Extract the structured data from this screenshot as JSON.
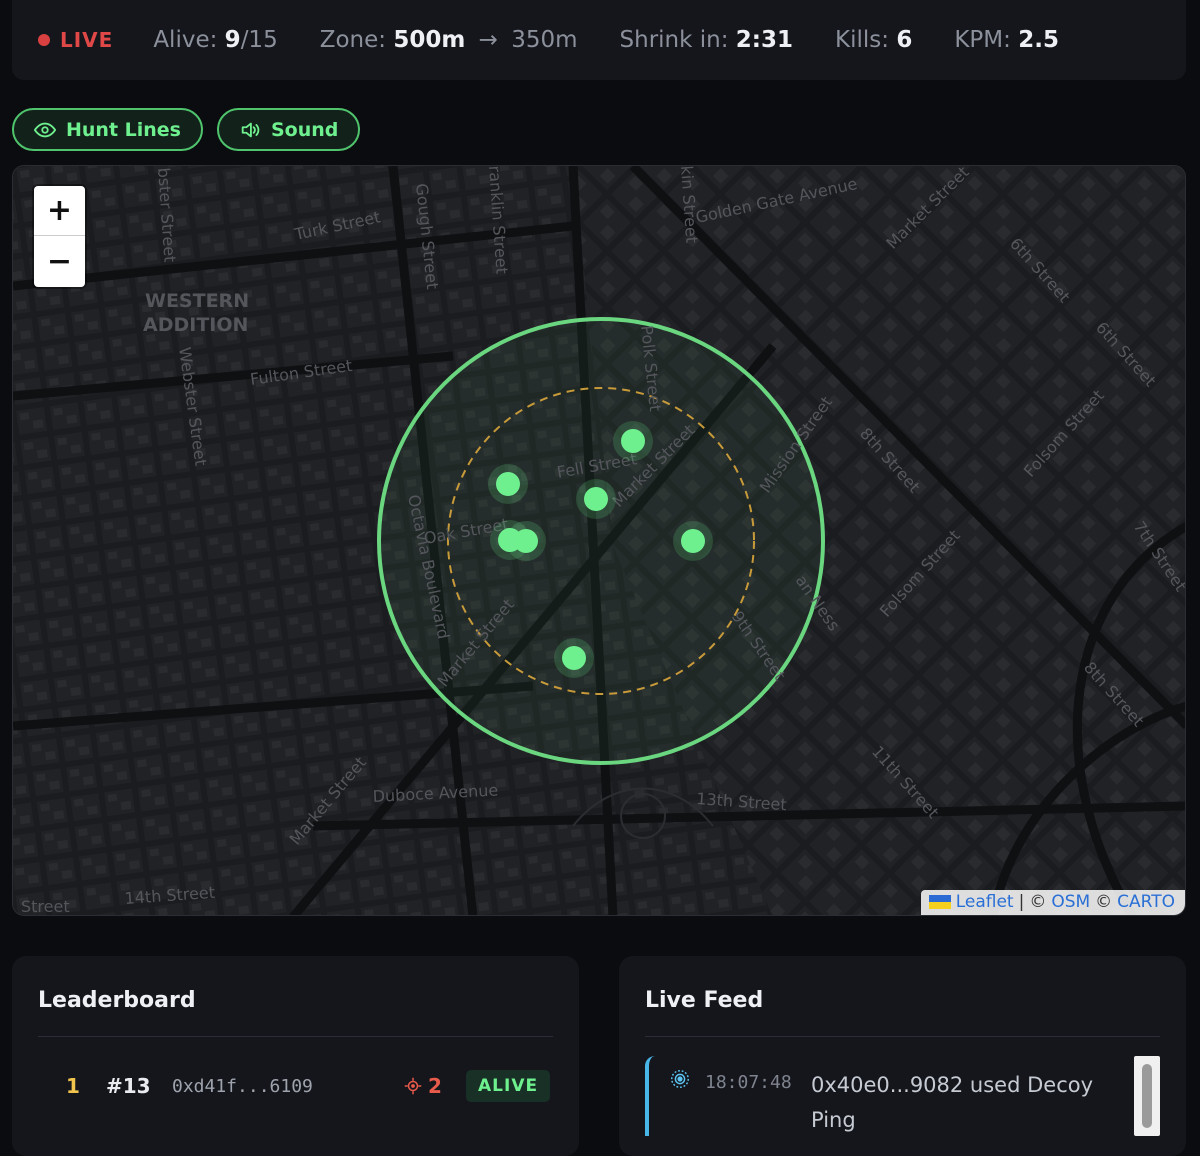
{
  "status": {
    "live_label": "LIVE",
    "alive_label": "Alive:",
    "alive_count": "9",
    "alive_total": "/15",
    "zone_label": "Zone:",
    "zone_current": "500m",
    "zone_arrow": "→",
    "zone_next": "350m",
    "shrink_label": "Shrink in:",
    "shrink_value": "2:31",
    "kills_label": "Kills:",
    "kills_value": "6",
    "kpm_label": "KPM:",
    "kpm_value": "2.5"
  },
  "toggles": {
    "hunt_lines": "Hunt Lines",
    "sound": "Sound"
  },
  "map": {
    "zoom_in": "+",
    "zoom_out": "−",
    "attribution": {
      "leaflet": "Leaflet",
      "sep": "|",
      "copy1": "©",
      "osm": "OSM",
      "copy2": "©",
      "carto": "CARTO"
    },
    "labels": {
      "western_addition_1": "WESTERN",
      "western_addition_2": "ADDITION",
      "turk": "Turk Street",
      "golden_gate": "Golden Gate Avenue",
      "fulton": "Fulton Street",
      "fell": "Fell Street",
      "oak": "Oak Street",
      "duboce": "Duboce Avenue",
      "thirteenth": "13th Street",
      "fourteenth": "14th Street",
      "street_corner": "Street",
      "webster": "Webster Street",
      "webster_top": "bster Street",
      "gough": "Gough Street",
      "franklin": "ranklin Street",
      "larkin": "kin Street",
      "polk": "Polk Street",
      "octavia": "Octavia Boulevard",
      "market_1": "Market Street",
      "market_2": "Market Street",
      "market_3": "Market Street",
      "market_4": "Market Street",
      "market_5": "Market Street",
      "mission": "Mission Street",
      "sixth_1": "6th Street",
      "sixth_2": "6th Street",
      "seventh": "7th Street",
      "eighth_1": "8th Street",
      "eighth_2": "8th Street",
      "eleventh": "11th Street",
      "folsom_1": "Folsom Street",
      "folsom_2": "Folsom Street",
      "ninth": "9th Street",
      "van_ness": "an Ness"
    },
    "colors": {
      "zone": "#6ad67f",
      "next_zone": "#c89a3a",
      "player": "#6ff08f"
    },
    "player_count": 7
  },
  "leaderboard": {
    "title": "Leaderboard",
    "rows": [
      {
        "rank": "1",
        "id": "#13",
        "address": "0xd41f...6109",
        "kills": "2",
        "status": "ALIVE"
      }
    ]
  },
  "feed": {
    "title": "Live Feed",
    "items": [
      {
        "icon": "radar-icon",
        "time": "18:07:48",
        "text": "0x40e0...9082 used Decoy Ping"
      }
    ]
  }
}
